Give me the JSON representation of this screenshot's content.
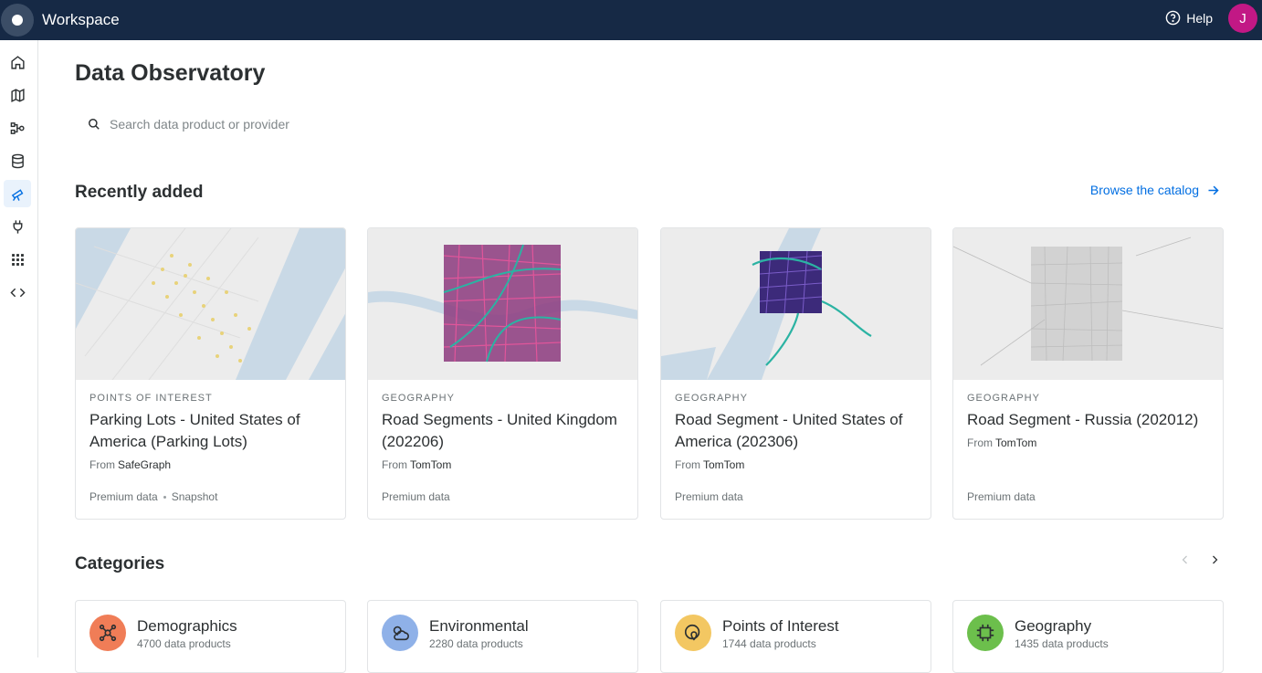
{
  "header": {
    "app_title": "Workspace",
    "help_label": "Help",
    "avatar_initial": "J",
    "brand_color": "#162945",
    "avatar_color": "#c21885"
  },
  "sidebar": {
    "items": [
      {
        "icon": "home-icon",
        "active": false
      },
      {
        "icon": "map-icon",
        "active": false
      },
      {
        "icon": "workflows-icon",
        "active": false
      },
      {
        "icon": "database-icon",
        "active": false
      },
      {
        "icon": "telescope-icon",
        "active": true
      },
      {
        "icon": "plug-icon",
        "active": false
      },
      {
        "icon": "apps-grid-icon",
        "active": false
      },
      {
        "icon": "code-icon",
        "active": false
      }
    ]
  },
  "page": {
    "title": "Data Observatory",
    "search_placeholder": "Search data product or provider",
    "recent_title": "Recently added",
    "browse_label": "Browse the catalog",
    "categories_title": "Categories",
    "accent_color": "#036fe2"
  },
  "recent": [
    {
      "category": "POINTS OF INTEREST",
      "title": "Parking Lots - United States of America (Parking Lots)",
      "from_label": "From",
      "provider": "SafeGraph",
      "tags": [
        "Premium data",
        "Snapshot"
      ]
    },
    {
      "category": "GEOGRAPHY",
      "title": "Road Segments - United Kingdom (202206)",
      "from_label": "From",
      "provider": "TomTom",
      "tags": [
        "Premium data"
      ]
    },
    {
      "category": "GEOGRAPHY",
      "title": "Road Segment - United States of America (202306)",
      "from_label": "From",
      "provider": "TomTom",
      "tags": [
        "Premium data"
      ]
    },
    {
      "category": "GEOGRAPHY",
      "title": "Road Segment - Russia (202012)",
      "from_label": "From",
      "provider": "TomTom",
      "tags": [
        "Premium data"
      ]
    }
  ],
  "categories": [
    {
      "name": "Demographics",
      "count": "4700 data products",
      "icon": "demographics-icon",
      "color": "#f07d57"
    },
    {
      "name": "Environmental",
      "count": "2280 data products",
      "icon": "environmental-icon",
      "color": "#8fb1e8"
    },
    {
      "name": "Points of Interest",
      "count": "1744 data products",
      "icon": "poi-icon",
      "color": "#f3c762"
    },
    {
      "name": "Geography",
      "count": "1435 data products",
      "icon": "geography-icon",
      "color": "#6cbf4c"
    }
  ]
}
